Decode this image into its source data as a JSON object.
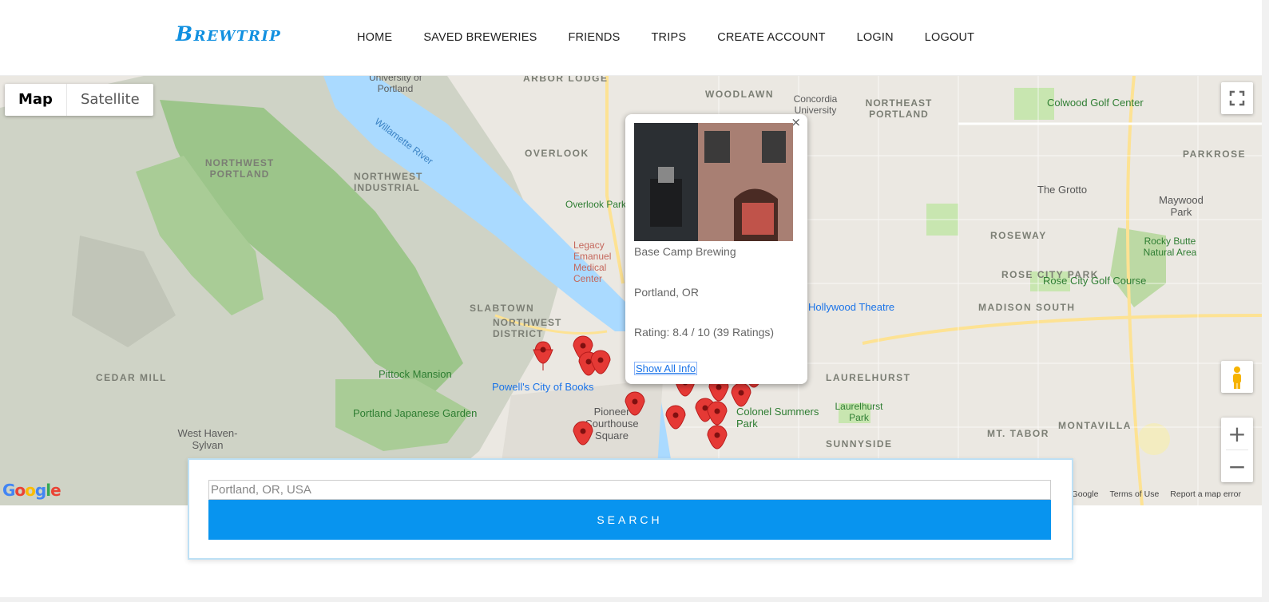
{
  "brand": "Brewtrip",
  "nav": [
    "HOME",
    "SAVED BREWERIES",
    "FRIENDS",
    "TRIPS",
    "CREATE ACCOUNT",
    "LOGIN",
    "LOGOUT"
  ],
  "map": {
    "type_active": "Map",
    "type_inactive": "Satellite",
    "labels": {
      "northwest_portland": "NORTHWEST PORTLAND",
      "northwest_industrial": "NORTHWEST INDUSTRIAL",
      "overlook": "OVERLOOK",
      "woodlawn": "WOODLAWN",
      "northeast_portland": "NORTHEAST PORTLAND",
      "parkrose": "PARKROSE",
      "roseway": "ROSEWAY",
      "rose_city_park": "ROSE CITY PARK",
      "madison_south": "MADISON SOUTH",
      "laurelhurst": "LAURELHURST",
      "sunnyside": "SUNNYSIDE",
      "mt_tabor": "MT. TABOR",
      "montavilla": "MONTAVILLA",
      "slabtown": "SLABTOWN",
      "northwest_district": "NORTHWEST DISTRICT",
      "cedar_mill": "CEDAR MILL",
      "west_haven": "West Haven-Sylvan",
      "university": "University of Portland",
      "concordia": "Concordia University",
      "colwood": "Colwood Golf Center",
      "grotto": "The Grotto",
      "maywood": "Maywood Park",
      "rocky_butte": "Rocky Butte Natural Area",
      "rose_city_golf": "Rose City Golf Course",
      "overlook_park": "Overlook Park",
      "pittock": "Pittock Mansion",
      "japanese_garden": "Portland Japanese Garden",
      "powells": "Powell's City of Books",
      "pioneer": "Pioneer Courthouse Square",
      "colonel": "Colonel Summers Park",
      "laurelhurst_park": "Laurelhurst Park",
      "hollywood": "Hollywood Theatre",
      "willamette": "Willamette River",
      "legacy": "Legacy Emanuel Medical Center",
      "arbor_lodge": "ARBOR LODGE"
    },
    "attribution": [
      "©2019 Google",
      "Terms of Use",
      "Report a map error"
    ],
    "google_logo": "Google"
  },
  "infowindow": {
    "close": "×",
    "name": "Base Camp Brewing",
    "location": "Portland, OR",
    "rating": "Rating: 8.4 / 10 (39 Ratings)",
    "link": "Show All Info"
  },
  "search": {
    "placeholder": "Portland, OR, USA",
    "button": "SEARCH"
  },
  "colors": {
    "brand": "#1190e0",
    "button": "#0894ef",
    "water": "#aadaff",
    "park": "#c8e6b0",
    "marker": "#e53935"
  }
}
